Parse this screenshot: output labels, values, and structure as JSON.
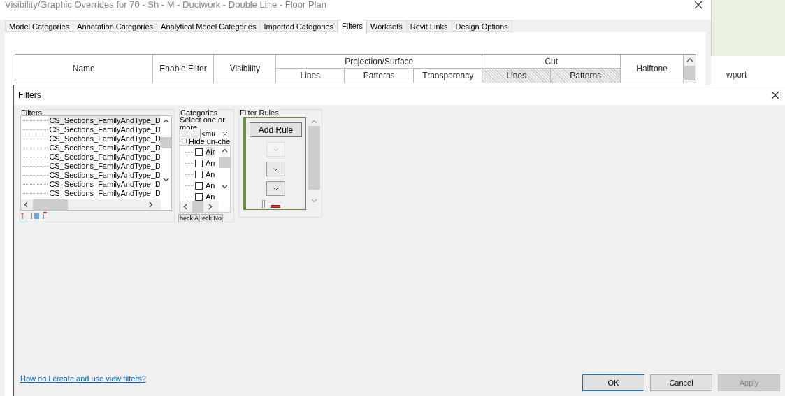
{
  "window": {
    "title": "Visibility/Graphic Overrides for 70 - Sh - M - Ductwork - Double Line - Floor Plan"
  },
  "tabs": [
    {
      "label": "Model Categories",
      "selected": false
    },
    {
      "label": "Annotation Categories",
      "selected": false
    },
    {
      "label": "Analytical Model Categories",
      "selected": false
    },
    {
      "label": "Imported Categories",
      "selected": false
    },
    {
      "label": "Filters",
      "selected": true
    },
    {
      "label": "Worksets",
      "selected": false
    },
    {
      "label": "Revit Links",
      "selected": false
    },
    {
      "label": "Design Options",
      "selected": false
    }
  ],
  "table": {
    "columns": [
      "Name",
      "Enable Filter",
      "Visibility"
    ],
    "groups": [
      {
        "label": "Projection/Surface",
        "columns": [
          "Lines",
          "Patterns",
          "Transparency"
        ]
      },
      {
        "label": "Cut",
        "columns": [
          "Lines",
          "Patterns"
        ]
      }
    ],
    "last_column": "Halftone"
  },
  "background_text": "wport",
  "dialog": {
    "title": "Filters",
    "filters": {
      "label": "Filters",
      "items": [
        {
          "name": "CS_Sections_FamilyAndType_D",
          "selected": true
        },
        {
          "name": "CS_Sections_FamilyAndType_D",
          "selected": false
        },
        {
          "name": "CS_Sections_FamilyAndType_D",
          "selected": false
        },
        {
          "name": "CS_Sections_FamilyAndType_D",
          "selected": false
        },
        {
          "name": "CS_Sections_FamilyAndType_D",
          "selected": false
        },
        {
          "name": "CS_Sections_FamilyAndType_D",
          "selected": false
        },
        {
          "name": "CS_Sections_FamilyAndType_D",
          "selected": false
        },
        {
          "name": "CS_Sections_FamilyAndType_D",
          "selected": false
        },
        {
          "name": "CS_Sections_FamilyAndType_D",
          "selected": false
        }
      ]
    },
    "categories": {
      "label": "Categories",
      "hint": "Select one or",
      "hint_2": "more",
      "filter_value": "<mu",
      "hide_unchecked": {
        "label": "Hide un-che",
        "checked": false
      },
      "items": [
        {
          "name": "Air",
          "checked": false,
          "selected": true
        },
        {
          "name": "An",
          "checked": false,
          "selected": false
        },
        {
          "name": "An",
          "checked": false,
          "selected": false
        },
        {
          "name": "An",
          "checked": false,
          "selected": false
        },
        {
          "name": "An",
          "checked": false,
          "selected": false
        }
      ],
      "buttons": [
        "heck A",
        "eck No"
      ]
    },
    "rules": {
      "label": "Filter Rules",
      "add_button": "Add Rule",
      "dropdowns": [
        {
          "disabled": true
        },
        {
          "disabled": false
        },
        {
          "disabled": false
        }
      ]
    },
    "help_link": "How do I create and use view filters?",
    "buttons": [
      {
        "label": "OK",
        "default": true,
        "disabled": false
      },
      {
        "label": "Cancel",
        "default": false,
        "disabled": false
      },
      {
        "label": "Apply",
        "default": false,
        "disabled": true
      }
    ]
  }
}
